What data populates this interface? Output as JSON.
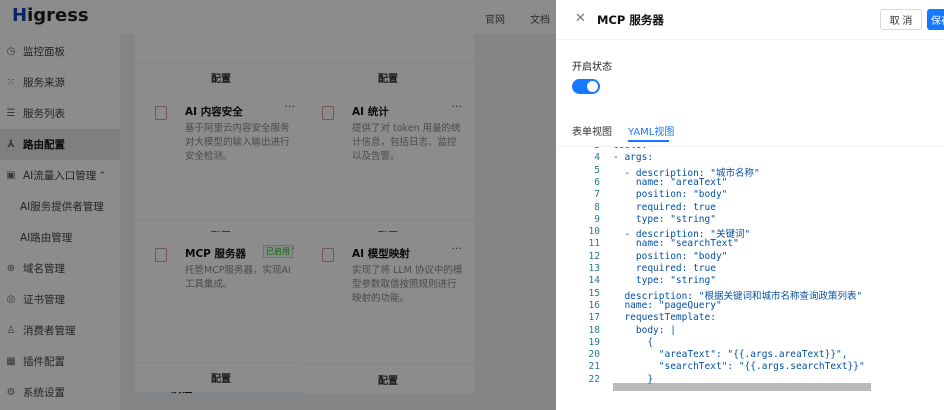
{
  "sidebar": {
    "logo": "Higress",
    "items": [
      {
        "label": "监控面板",
        "icon": "dashboard-icon"
      },
      {
        "label": "服务来源",
        "icon": "source-icon"
      },
      {
        "label": "服务列表",
        "icon": "list-icon"
      },
      {
        "label": "路由配置",
        "icon": "route-icon",
        "active": true
      },
      {
        "label": "AI流量入口管理",
        "icon": "ai-icon",
        "expanded": true
      },
      {
        "label": "AI服务提供者管理",
        "sub": true
      },
      {
        "label": "AI路由管理",
        "sub": true
      },
      {
        "label": "域名管理",
        "icon": "globe-icon"
      },
      {
        "label": "证书管理",
        "icon": "certificate-icon"
      },
      {
        "label": "消费者管理",
        "icon": "user-icon"
      },
      {
        "label": "插件配置",
        "icon": "plugin-icon"
      },
      {
        "label": "系统设置",
        "icon": "gear-icon"
      }
    ]
  },
  "topbar": {
    "official": "官网",
    "docs": "文档"
  },
  "cards": [
    {
      "title": "",
      "desc": "",
      "config": "配置"
    },
    {
      "title": "",
      "desc": "",
      "config": "配置"
    },
    {
      "title": "AI 内容安全",
      "desc": "基于阿里云内容安全服务对大模型的输入输出进行安全检测。",
      "config": "配置"
    },
    {
      "title": "AI 统计",
      "desc": "提供了对 token 用量的统计信息，包括日志、监控以及告警。",
      "config": "配置"
    },
    {
      "title": "MCP 服务器",
      "tag": "已启用",
      "desc": "托管MCP服务器，实现AI工具集成。",
      "config": "配置"
    },
    {
      "title": "AI 模型映射",
      "desc": "实现了将 LLM 协议中的模型参数取值按照规则进行映射的功能。",
      "config": "配置"
    }
  ],
  "section": "认证",
  "drawer": {
    "title": "MCP 服务器",
    "cancel": "取 消",
    "save": "保存",
    "status_label": "开启状态",
    "enabled": true,
    "tabs": [
      "表单视图",
      "YAML视图"
    ],
    "active_tab": "YAML视图",
    "code": [
      {
        "n": "3",
        "t": "tools:"
      },
      {
        "n": "4",
        "t": "- args:"
      },
      {
        "n": "5",
        "t": "  - description: \"城市名称\""
      },
      {
        "n": "6",
        "t": "    name: \"areaText\""
      },
      {
        "n": "7",
        "t": "    position: \"body\""
      },
      {
        "n": "8",
        "t": "    required: true"
      },
      {
        "n": "9",
        "t": "    type: \"string\""
      },
      {
        "n": "10",
        "t": "  - description: \"关键词\""
      },
      {
        "n": "11",
        "t": "    name: \"searchText\""
      },
      {
        "n": "12",
        "t": "    position: \"body\""
      },
      {
        "n": "13",
        "t": "    required: true"
      },
      {
        "n": "14",
        "t": "    type: \"string\""
      },
      {
        "n": "15",
        "t": "  description: \"根据关键词和城市名称查询政策列表\""
      },
      {
        "n": "16",
        "t": "  name: \"pageQuery\""
      },
      {
        "n": "17",
        "t": "  requestTemplate:"
      },
      {
        "n": "18",
        "t": "    body: |"
      },
      {
        "n": "19",
        "t": "      {"
      },
      {
        "n": "20",
        "t": "        \"areaText\": \"{{.args.areaText}}\","
      },
      {
        "n": "21",
        "t": "        \"searchText\": \"{{.args.searchText}}\""
      },
      {
        "n": "22",
        "t": "      }"
      }
    ]
  }
}
